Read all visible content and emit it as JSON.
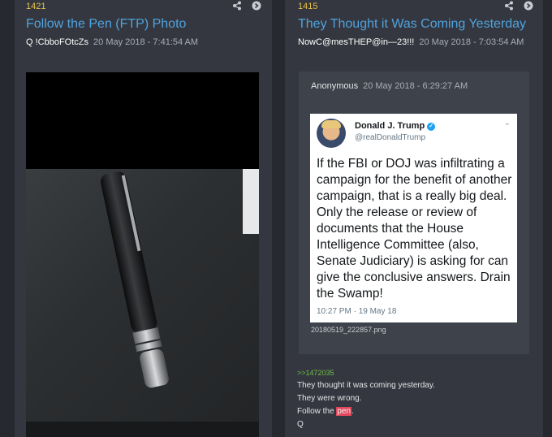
{
  "left_post": {
    "number": "1421",
    "title": "Follow the Pen (FTP) Photo",
    "author": "Q !CbboFOtcZs",
    "date": "20 May 2018 - 7:41:54 AM",
    "icons": [
      "share-icon",
      "arrow-circle-icon"
    ]
  },
  "right_post": {
    "number": "1415",
    "title": "They Thought it Was Coming Yesterday",
    "author": "NowC@mesTHEP@in—23!!!",
    "date": "20 May 2018 - 7:03:54 AM",
    "icons": [
      "share-icon",
      "arrow-circle-icon"
    ],
    "quote": {
      "author": "Anonymous",
      "date": "20 May 2018 - 6:29:27 AM",
      "tweet": {
        "name": "Donald J. Trump",
        "handle": "@realDonaldTrump",
        "text": "If the FBI or DOJ was infiltrating a campaign for the benefit of another campaign, that is a really big deal. Only the release or review of documents that the House Intelligence Committee (also, Senate Judiciary) is asking for can give the conclusive answers. Drain the Swamp!",
        "time": "10:27 PM · 19 May 18"
      },
      "filename": "20180519_222857.png"
    },
    "reply": {
      "ref": ">>1472035",
      "line1": "They thought it was coming yesterday.",
      "line2": "They were wrong.",
      "line3_prefix": "Follow the ",
      "line3_highlight": "pen",
      "line3_suffix": ".",
      "line4": "Q"
    }
  },
  "colors": {
    "background": "#33363d",
    "title_blue": "#4fa3df",
    "post_number_yellow": "#e6c14a",
    "reference_green": "#6fbf4a",
    "highlight_red": "#e1485c",
    "twitter_blue": "#1da1f2"
  }
}
